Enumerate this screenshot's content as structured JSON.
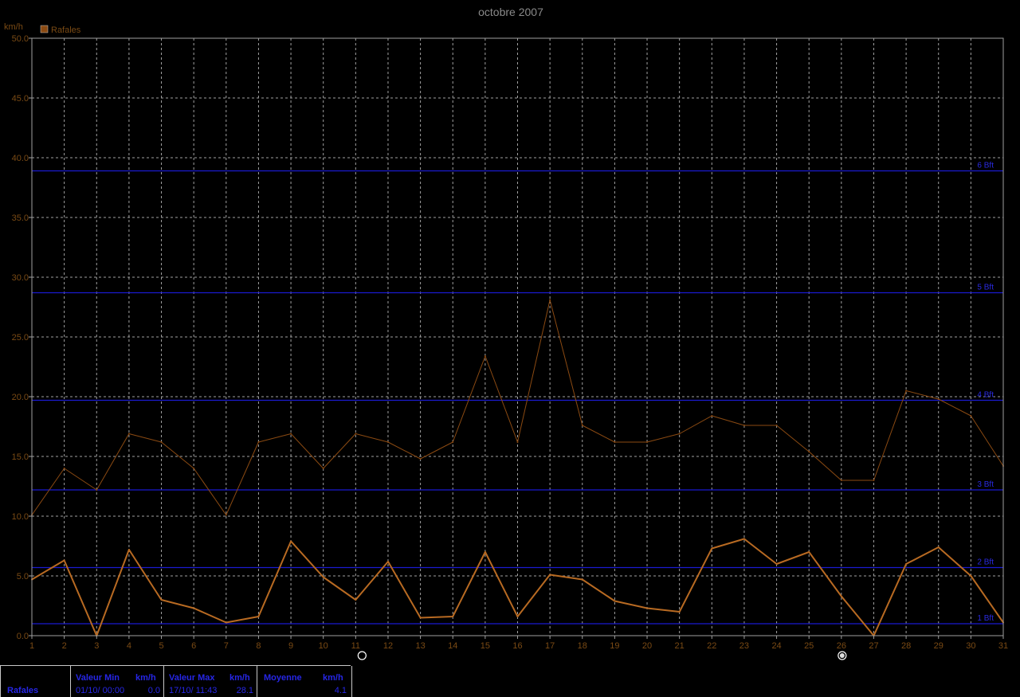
{
  "chart_data": {
    "type": "line",
    "title": "octobre 2007",
    "ylabel": "km/h",
    "ylim": [
      0,
      50
    ],
    "yticks": [
      "0.0",
      "5.0",
      "10.0",
      "15.0",
      "20.0",
      "25.0",
      "30.0",
      "35.0",
      "40.0",
      "45.0",
      "50.0"
    ],
    "x": [
      1,
      2,
      3,
      4,
      5,
      6,
      7,
      8,
      9,
      10,
      11,
      12,
      13,
      14,
      15,
      16,
      17,
      18,
      19,
      20,
      21,
      22,
      23,
      24,
      25,
      26,
      27,
      28,
      29,
      30,
      31
    ],
    "xlim": [
      1,
      31
    ],
    "grid": true,
    "legend": "top-left",
    "legend_label": "Rafales",
    "series": [
      {
        "name": "Rafales",
        "role": "max",
        "color": "#8b4a12",
        "values": [
          10.1,
          14.0,
          12.2,
          16.9,
          16.2,
          14.0,
          10.1,
          16.2,
          16.9,
          14.0,
          16.9,
          16.2,
          14.8,
          16.2,
          23.4,
          16.2,
          28.1,
          17.6,
          16.2,
          16.2,
          16.9,
          18.4,
          17.6,
          17.6,
          15.4,
          13.0,
          13.0,
          20.5,
          19.8,
          18.4,
          14.2
        ]
      },
      {
        "name": "",
        "role": "mean",
        "color": "#b86a22",
        "values": [
          4.7,
          6.3,
          0.0,
          7.2,
          3.0,
          2.3,
          1.1,
          1.6,
          7.9,
          4.9,
          3.0,
          6.2,
          1.5,
          1.6,
          7.0,
          1.6,
          5.1,
          4.7,
          2.9,
          2.3,
          2.0,
          7.3,
          8.1,
          6.0,
          7.0,
          3.3,
          0.0,
          6.0,
          7.4,
          5.0,
          1.1
        ]
      }
    ],
    "reference_lines": [
      {
        "label": "1 Bft",
        "value": 1.0
      },
      {
        "label": "2 Bft",
        "value": 5.7
      },
      {
        "label": "3 Bft",
        "value": 12.2
      },
      {
        "label": "4 Bft",
        "value": 19.7
      },
      {
        "label": "5 Bft",
        "value": 28.7
      },
      {
        "label": "6 Bft",
        "value": 38.9
      }
    ],
    "moon_phases": [
      {
        "x": 11,
        "icon": "new-moon-icon"
      },
      {
        "x": 26,
        "icon": "full-moon-icon"
      }
    ]
  },
  "colors": {
    "background": "#000000",
    "grid": "#a0a0a0",
    "axis_text": "#7a4a14",
    "reference": "#1a1ad0",
    "stats_text": "#2626e6"
  },
  "stats": {
    "series": "Rafales",
    "min_header": "Valeur Min",
    "min_unit": "km/h",
    "min_date": "01/10/ 00:00",
    "min_value": "0.0",
    "max_header": "Valeur Max",
    "max_unit": "km/h",
    "max_date": "17/10/ 11:43",
    "max_value": "28.1",
    "avg_header": "Moyenne",
    "avg_unit": "km/h",
    "avg_value": "4.1"
  }
}
